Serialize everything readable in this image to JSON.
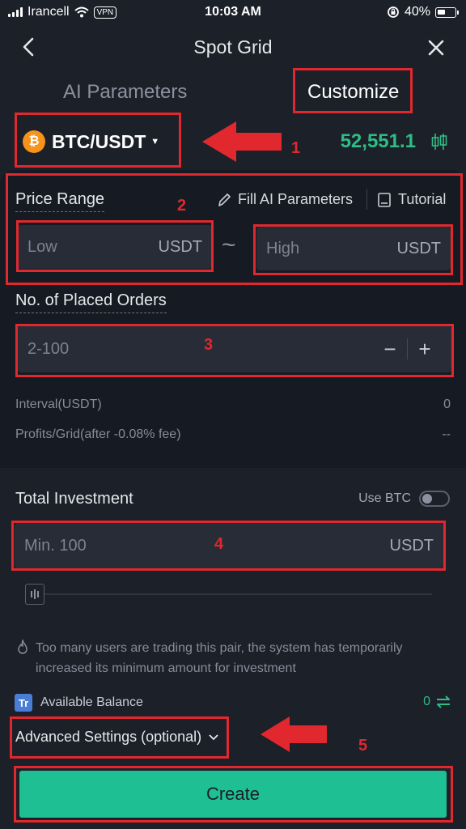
{
  "status_bar": {
    "carrier": "Irancell",
    "vpn": "VPN",
    "time": "10:03 AM",
    "battery": "40%"
  },
  "header": {
    "title": "Spot Grid"
  },
  "tabs": [
    {
      "label": "AI Parameters",
      "active": false
    },
    {
      "label": "Customize",
      "active": true
    }
  ],
  "pair": {
    "coin_symbol": "₿",
    "name": "BTC/USDT",
    "price": "52,551.1"
  },
  "price_range": {
    "label": "Price Range",
    "fill_ai": "Fill AI Parameters",
    "tutorial": "Tutorial",
    "low_placeholder": "Low",
    "high_placeholder": "High",
    "unit": "USDT",
    "separator": "~"
  },
  "orders": {
    "label": "No. of Placed Orders",
    "placeholder": "2-100",
    "minus": "−",
    "plus": "+"
  },
  "info": {
    "interval_label": "Interval(USDT)",
    "interval_value": "0",
    "profit_label": "Profits/Grid(after -0.08% fee)",
    "profit_value": "--"
  },
  "investment": {
    "label": "Total Investment",
    "use_btc": "Use BTC",
    "use_btc_on": false,
    "placeholder": "Min. 100",
    "unit": "USDT",
    "slider_level": 0
  },
  "warning": "Too many users are trading this pair, the system has temporarily increased its minimum amount for investment",
  "balance": {
    "icon_text": "Tr",
    "label": "Available Balance",
    "value": "0"
  },
  "advanced": {
    "label": "Advanced Settings (optional)"
  },
  "create_button": "Create",
  "annotations": [
    "1",
    "2",
    "3",
    "4",
    "5"
  ],
  "colors": {
    "background": "#1b2029",
    "panel": "#161a22",
    "accent_green": "#2ebd85",
    "create_button": "#1fbf94",
    "annotation_red": "#e0282e"
  }
}
